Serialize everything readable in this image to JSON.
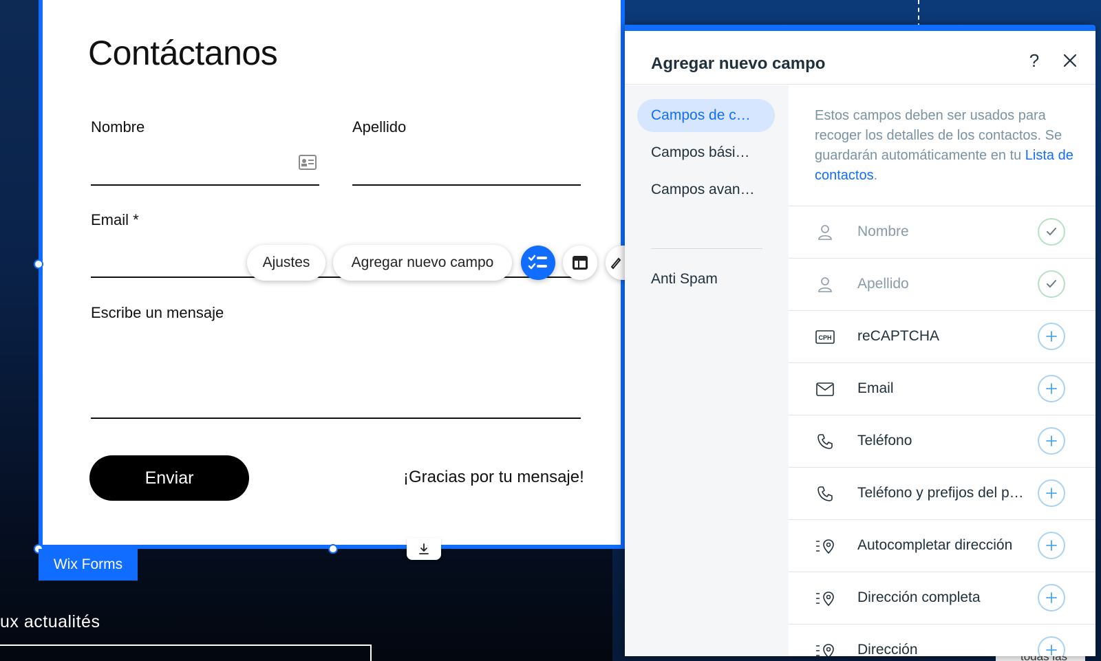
{
  "form": {
    "title": "Contáctanos",
    "first_name_label": "Nombre",
    "last_name_label": "Apellido",
    "email_label": "Email *",
    "message_label": "Escribe un mensaje",
    "submit_label": "Enviar",
    "success_message": "¡Gracias por tu mensaje!",
    "tag": "Wix Forms"
  },
  "toolbar": {
    "settings_label": "Ajustes",
    "add_field_label": "Agregar nuevo campo",
    "icons": [
      "manage-fields-icon",
      "layout-icon",
      "design-brush-icon"
    ]
  },
  "background": {
    "bottom_text": "ux actualités",
    "bottom_right_text": "todas las"
  },
  "panel": {
    "title": "Agregar nuevo campo",
    "help_label": "?",
    "nav": [
      {
        "label": "Campos de c…",
        "selected": true
      },
      {
        "label": "Campos bási…",
        "selected": false
      },
      {
        "label": "Campos avan…",
        "selected": false
      },
      {
        "label": "Anti Spam",
        "selected": false
      }
    ],
    "description": "Estos campos deben ser usados para recoger los detalles de los contactos. Se guardarán automáticamente en tu ",
    "description_link": "Lista de contactos",
    "description_end": ".",
    "fields": [
      {
        "label": "Nombre",
        "icon": "person-icon",
        "state": "added"
      },
      {
        "label": "Apellido",
        "icon": "person-icon",
        "state": "added"
      },
      {
        "label": "reCAPTCHA",
        "icon": "captcha-icon",
        "state": "add"
      },
      {
        "label": "Email",
        "icon": "envelope-icon",
        "state": "add"
      },
      {
        "label": "Teléfono",
        "icon": "phone-icon",
        "state": "add"
      },
      {
        "label": "Teléfono y prefijos del p…",
        "icon": "phone-icon",
        "state": "add"
      },
      {
        "label": "Autocompletar dirección",
        "icon": "location-pin-icon",
        "state": "add"
      },
      {
        "label": "Dirección completa",
        "icon": "location-pin-icon",
        "state": "add"
      },
      {
        "label": "Dirección",
        "icon": "location-pin-icon",
        "state": "add"
      }
    ]
  },
  "colors": {
    "accent": "#116dff",
    "selected_nav_bg": "#d6e6fe",
    "check_ring": "#b8e0c4",
    "add_ring": "#a8d3f4"
  }
}
